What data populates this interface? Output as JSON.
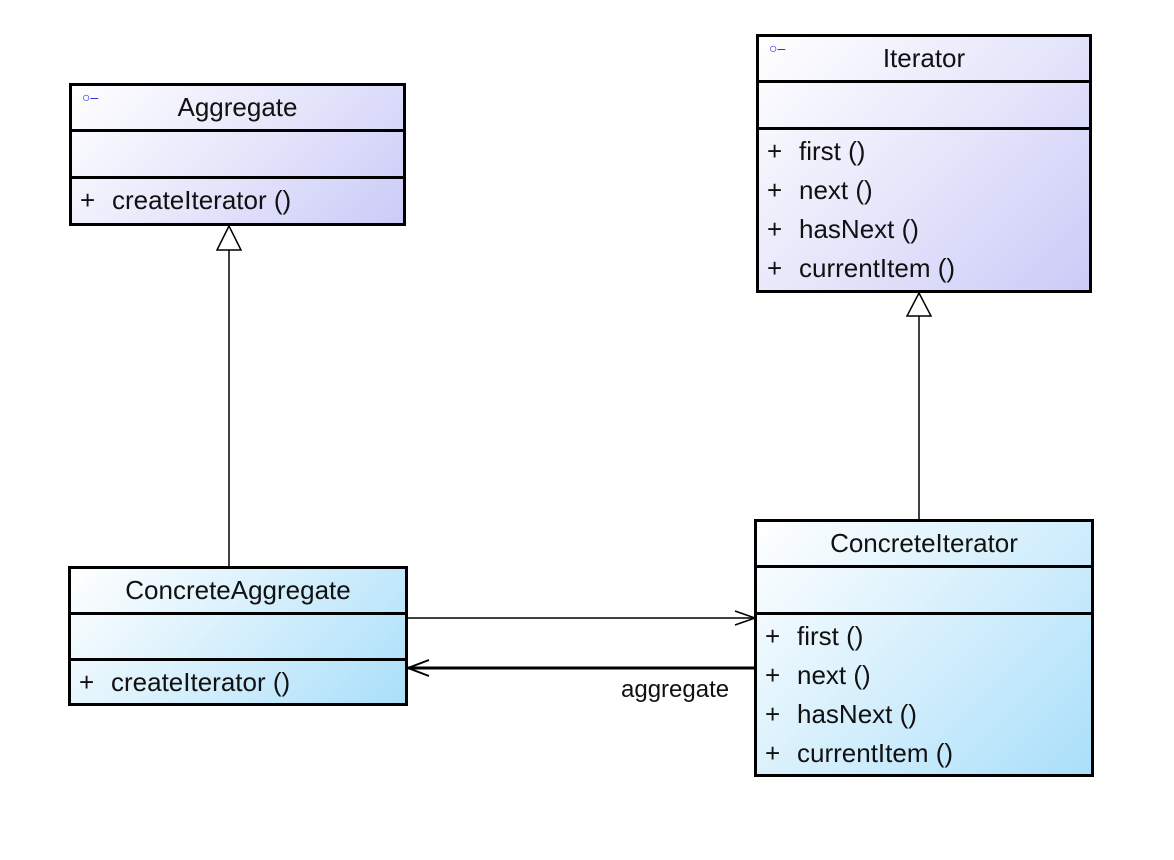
{
  "classes": {
    "aggregate": {
      "name": "Aggregate",
      "stereotype_icon": "interface-lollipop-icon",
      "operations": [
        {
          "visibility": "+",
          "name": "createIterator ()"
        }
      ]
    },
    "iterator": {
      "name": "Iterator",
      "stereotype_icon": "interface-lollipop-icon",
      "operations": [
        {
          "visibility": "+",
          "name": "first ()"
        },
        {
          "visibility": "+",
          "name": "next ()"
        },
        {
          "visibility": "+",
          "name": "hasNext ()"
        },
        {
          "visibility": "+",
          "name": "currentItem ()"
        }
      ]
    },
    "concrete_aggregate": {
      "name": "ConcreteAggregate",
      "operations": [
        {
          "visibility": "+",
          "name": "createIterator ()"
        }
      ]
    },
    "concrete_iterator": {
      "name": "ConcreteIterator",
      "operations": [
        {
          "visibility": "+",
          "name": "first ()"
        },
        {
          "visibility": "+",
          "name": "next ()"
        },
        {
          "visibility": "+",
          "name": "hasNext ()"
        },
        {
          "visibility": "+",
          "name": "currentItem ()"
        }
      ]
    }
  },
  "relations": {
    "association_label": "aggregate"
  },
  "colors": {
    "interface_fill": "#cbcbf8",
    "class_fill": "#aadffa",
    "icon": "#2222dd"
  }
}
